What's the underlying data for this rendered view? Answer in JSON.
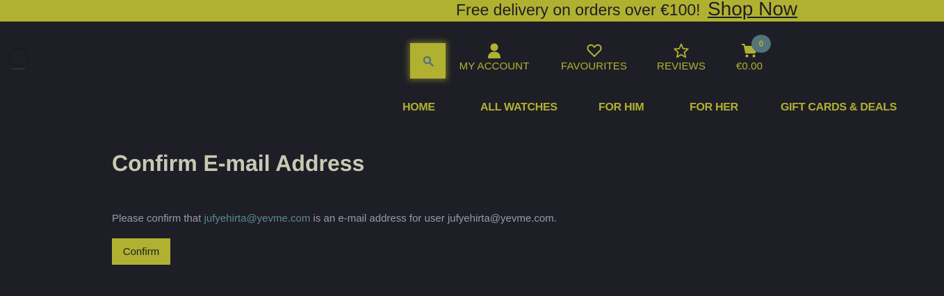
{
  "banner": {
    "text": "Free delivery on orders over €100!",
    "link": "Shop Now",
    "background": "#b1b131"
  },
  "logo": {
    "icon": "clock-logo-icon"
  },
  "header": {
    "search_icon": "search-icon",
    "account": {
      "icon": "user-icon",
      "label": "MY ACCOUNT"
    },
    "favourites": {
      "icon": "heart-icon",
      "label": "FAVOURITES"
    },
    "reviews": {
      "icon": "star-icon",
      "label": "REVIEWS"
    },
    "cart": {
      "icon": "cart-icon",
      "total": "€0.00",
      "count": "0"
    }
  },
  "nav": {
    "items": [
      {
        "label": "HOME"
      },
      {
        "label": "ALL WATCHES"
      },
      {
        "label": "FOR HIM"
      },
      {
        "label": "FOR HER"
      },
      {
        "label": "GIFT CARDS & DEALS"
      }
    ]
  },
  "main": {
    "title": "Confirm E-mail Address",
    "message_prefix": "Please confirm that",
    "email": "jufyehirta@yevme.com",
    "message_suffix": "is an e-mail address for user jufyehirta@yevme.com.",
    "confirm_label": "Confirm"
  },
  "colors": {
    "accent": "#b1b131",
    "background": "#1e1e26",
    "link": "#5a8a92",
    "badge": "#52747a"
  }
}
